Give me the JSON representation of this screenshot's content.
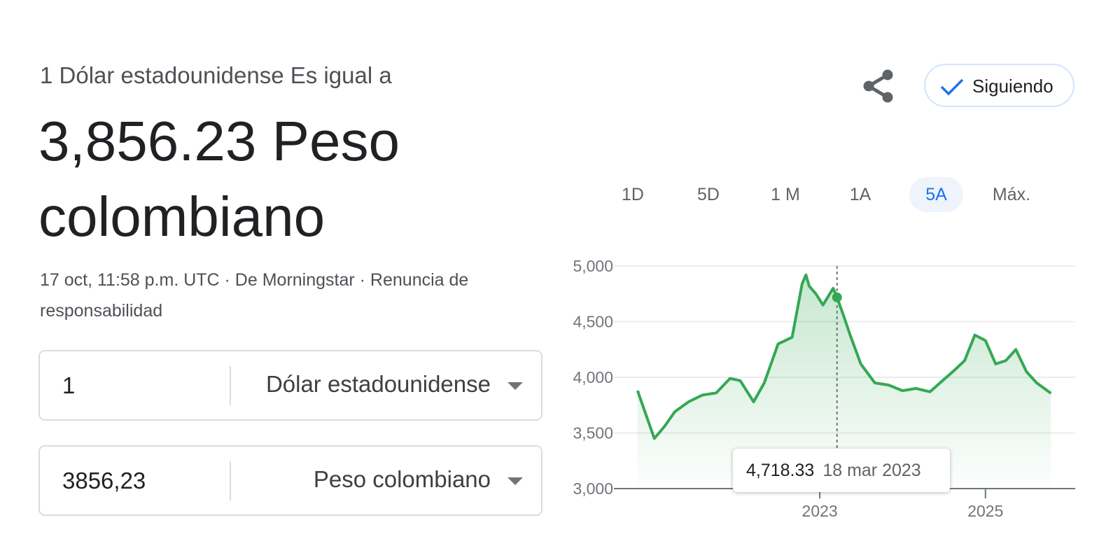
{
  "header": {
    "subtitle": "1 Dólar estadounidense Es igual a",
    "result": "3,856.23 Peso colombiano",
    "meta": "17 oct, 11:58 p.m. UTC · De Morningstar · Renuncia de responsabilidad"
  },
  "actions": {
    "share_icon": "share-icon",
    "follow_label": "Siguiendo"
  },
  "converter": {
    "from": {
      "value": "1",
      "currency": "Dólar estadounidense"
    },
    "to": {
      "value": "3856,23",
      "currency": "Peso colombiano"
    }
  },
  "range_tabs": [
    {
      "label": "1D",
      "active": false
    },
    {
      "label": "5D",
      "active": false
    },
    {
      "label": "1 M",
      "active": false
    },
    {
      "label": "1A",
      "active": false
    },
    {
      "label": "5A",
      "active": true
    },
    {
      "label": "Máx.",
      "active": false
    }
  ],
  "tooltip": {
    "value": "4,718.33",
    "date": "18 mar 2023"
  },
  "colors": {
    "line": "#34a853",
    "accent": "#1a73e8",
    "active_tab_bg": "#eef3fc"
  },
  "chart_data": {
    "type": "area",
    "ylim": [
      3000,
      5000
    ],
    "yticks": [
      "5,000",
      "4,500",
      "4,000",
      "3,500",
      "3,000"
    ],
    "xticks": [
      "2023",
      "2025"
    ],
    "grid": true,
    "hover": {
      "x": "2023-03-18",
      "y": 4718.33
    },
    "series": [
      {
        "x": [
          "2020-10-19",
          "2020-12-01",
          "2021-01-01",
          "2021-02-15",
          "2021-04-01",
          "2021-06-01",
          "2021-08-01",
          "2021-10-01",
          "2021-12-01",
          "2022-01-15",
          "2022-03-15",
          "2022-05-01",
          "2022-07-01",
          "2022-09-01",
          "2022-10-15",
          "2022-11-01",
          "2022-11-15",
          "2022-12-15",
          "2023-01-15",
          "2023-03-01",
          "2023-03-18",
          "2023-04-15",
          "2023-05-15",
          "2023-07-01",
          "2023-09-01",
          "2023-11-01",
          "2024-01-01",
          "2024-03-01",
          "2024-05-01",
          "2024-07-01",
          "2024-08-15",
          "2024-10-01",
          "2024-11-15",
          "2025-01-01",
          "2025-02-15",
          "2025-04-01",
          "2025-05-15",
          "2025-07-01",
          "2025-08-15",
          "2025-10-17"
        ],
        "y": [
          3880,
          3630,
          3450,
          3560,
          3690,
          3780,
          3840,
          3860,
          3990,
          3970,
          3780,
          3950,
          4300,
          4360,
          4840,
          4920,
          4820,
          4750,
          4650,
          4800,
          4718.33,
          4560,
          4380,
          4120,
          3950,
          3930,
          3880,
          3900,
          3870,
          3980,
          4060,
          4150,
          4380,
          4330,
          4120,
          4150,
          4250,
          4050,
          3950,
          3856.23
        ]
      }
    ]
  }
}
